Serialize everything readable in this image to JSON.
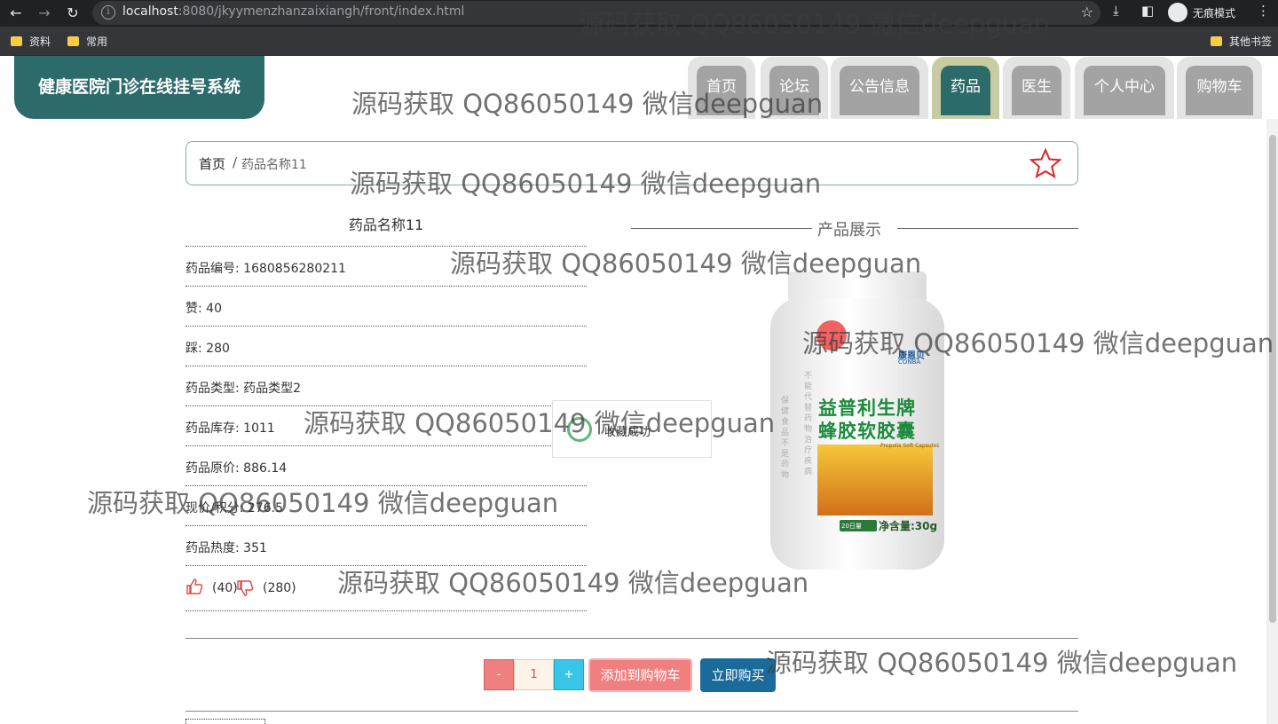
{
  "browser": {
    "url_host": "localhost",
    "url_rest": ":8080/jkyymenzhanzaixiangh/front/index.html",
    "incognito_label": "无痕模式",
    "bookmarks": [
      "资料",
      "常用"
    ],
    "other_bookmarks": "其他书签"
  },
  "site": {
    "title": "健康医院门诊在线挂号系统"
  },
  "nav": {
    "items": [
      "首页",
      "论坛",
      "公告信息",
      "药品",
      "医生",
      "个人中心",
      "购物车"
    ],
    "active": "药品"
  },
  "breadcrumb": {
    "home": "首页",
    "sep": "/",
    "current": "药品名称11"
  },
  "product": {
    "name": "药品名称11",
    "details": [
      "药品编号: 1680856280211",
      "赞: 40",
      "踩: 280",
      "药品类型: 药品类型2",
      "药品库存: 1011",
      "药品原价: 886.14",
      "现价/积分: 276.5",
      "药品热度: 351"
    ],
    "likes": "(40)",
    "dislikes": "(280)",
    "showcase_title": "产品展示"
  },
  "image_text": {
    "brand": "康恩贝",
    "brand_en": "CONBA",
    "line1": "益普利生牌",
    "line2": "蜂胶软胶囊",
    "weight": "净含量:30g",
    "days": "20日量",
    "sub": "Propolis Soft Capsules",
    "side": "不能代替药物治疗疾病",
    "side2": "保健食品不是药物"
  },
  "toast": {
    "message": "收藏成功"
  },
  "cart": {
    "minus": "-",
    "qty": "1",
    "plus": "+",
    "add_label": "添加到购物车",
    "buy_label": "立即购买"
  },
  "watermark": "源码获取 QQ86050149 微信deepguan"
}
